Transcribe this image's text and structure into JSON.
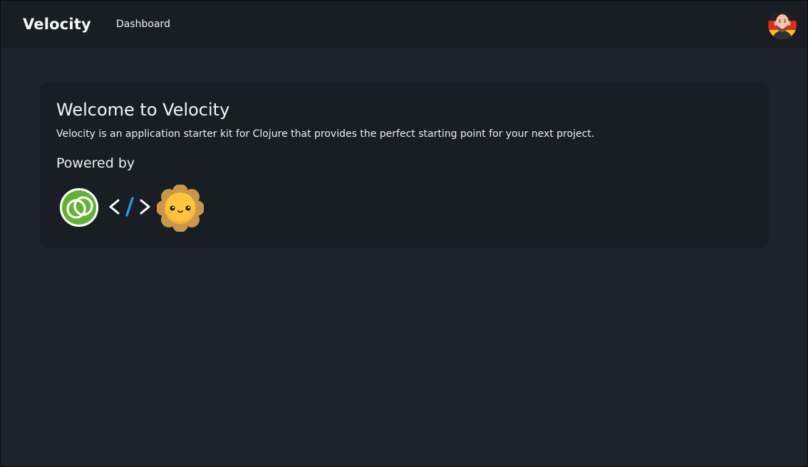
{
  "navbar": {
    "brand": "Velocity",
    "links": [
      {
        "label": "Dashboard"
      }
    ],
    "avatar_icon": "user-avatar-memoji"
  },
  "card": {
    "title": "Welcome to Velocity",
    "description": "Velocity is an application starter kit for Clojure that provides the perfect starting point for your next project.",
    "powered_by_heading": "Powered by",
    "logos": [
      {
        "icon": "clojure-logo"
      },
      {
        "icon": "html-tag-logo",
        "text": "</>"
      },
      {
        "icon": "sun-mascot-logo"
      }
    ]
  },
  "colors": {
    "page_background": "#1d232a",
    "surface": "#191e24",
    "text": "#f1f3f5",
    "accent_slash": "#1ba3e6"
  }
}
